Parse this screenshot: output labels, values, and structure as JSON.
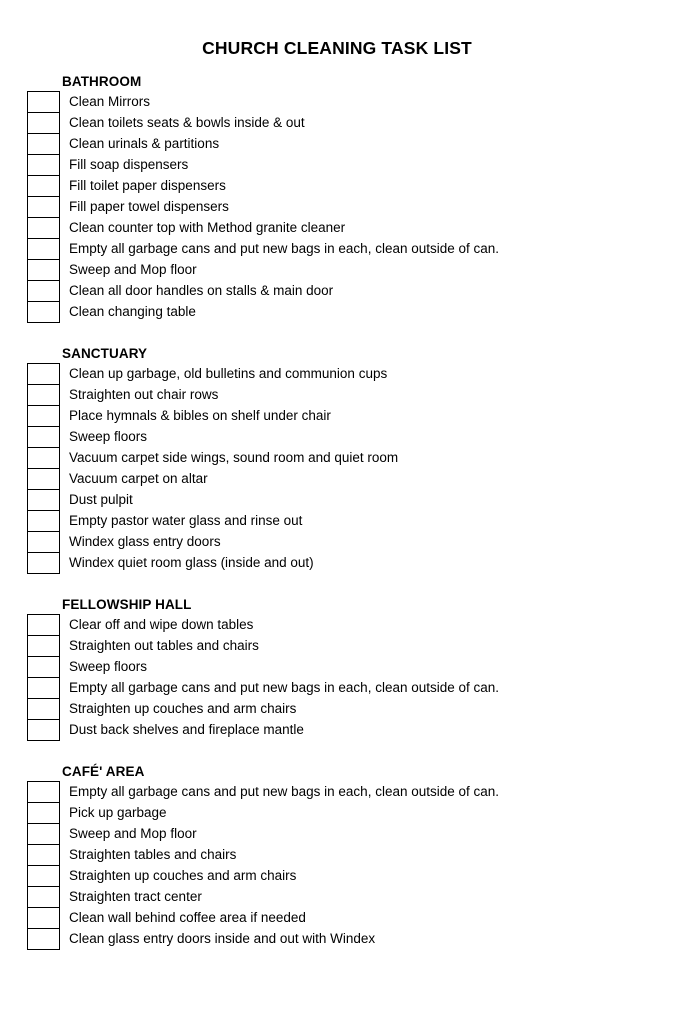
{
  "document": {
    "title": "CHURCH CLEANING TASK LIST"
  },
  "sections": [
    {
      "header": "BATHROOM",
      "tasks": [
        "Clean Mirrors",
        "Clean toilets seats & bowls inside & out",
        "Clean urinals & partitions",
        "Fill soap dispensers",
        "Fill toilet paper dispensers",
        "Fill paper towel dispensers",
        "Clean counter top with Method granite cleaner",
        "Empty all garbage cans and put new bags in each, clean outside of can.",
        "Sweep and Mop floor",
        "Clean all door handles on stalls & main door",
        "Clean changing table"
      ]
    },
    {
      "header": "SANCTUARY",
      "tasks": [
        "Clean up garbage, old bulletins and communion cups",
        "Straighten out chair rows",
        "Place hymnals & bibles on shelf under chair",
        "Sweep floors",
        "Vacuum carpet side wings, sound room and quiet room",
        "Vacuum carpet on altar",
        "Dust pulpit",
        "Empty pastor water glass and rinse out",
        "Windex glass entry doors",
        "Windex quiet room glass (inside and out)"
      ]
    },
    {
      "header": "FELLOWSHIP HALL",
      "tasks": [
        "Clear off and wipe down tables",
        "Straighten out tables and chairs",
        "Sweep floors",
        "Empty all garbage cans and put new bags in each, clean outside of can.",
        "Straighten up couches and arm chairs",
        "Dust back shelves and fireplace mantle"
      ]
    },
    {
      "header": "CAFÉ' AREA",
      "tasks": [
        "Empty all garbage cans and put new bags in each, clean outside of can.",
        "Pick up garbage",
        "Sweep and Mop floor",
        "Straighten tables and chairs",
        "Straighten up couches and arm chairs",
        "Straighten tract center",
        "Clean wall behind coffee area if needed",
        "Clean glass entry doors inside and out with Windex"
      ]
    }
  ]
}
